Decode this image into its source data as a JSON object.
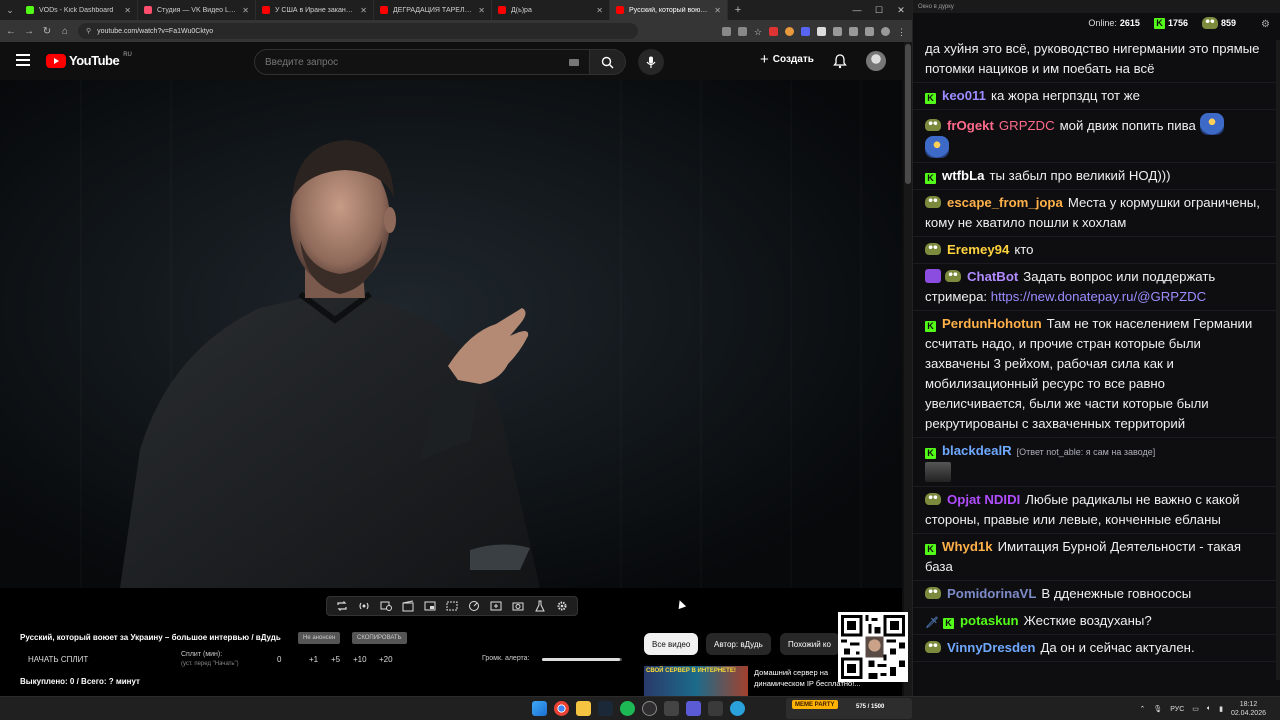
{
  "browser": {
    "tabs": [
      {
        "title": "VODs - Kick Dashboard",
        "color": "#53fc18",
        "active": false
      },
      {
        "title": "Студия — VK Видео Live",
        "color": "#ff4d6d",
        "active": false
      },
      {
        "title": "У США в Иране заканчиваются",
        "color": "#ff0000",
        "active": false
      },
      {
        "title": "ДЕГРАДАЦИЯ ТАРЕЛОЧНИЦ",
        "color": "#ff0000",
        "active": false
      },
      {
        "title": "Д(ь)ра",
        "color": "#ff0000",
        "active": false
      },
      {
        "title": "Русский, который воюет за Ук",
        "color": "#ff0000",
        "active": true
      }
    ],
    "url": "youtube.com/watch?v=Fa1Wu0Cktyo"
  },
  "youtube": {
    "logo_text": "YouTube",
    "logo_region": "RU",
    "search_placeholder": "Введите запрос",
    "create_label": "Создать"
  },
  "panel": {
    "video_title": "Русский, который воюет за Украину – большое интервью / вДудь",
    "pill_1": "Не анонсен",
    "pill_2": "СКОПИРОВАТЬ",
    "start_split": "НАЧАТЬ СПЛИТ",
    "split_label": "Сплит (мин):",
    "split_hint": "(уст. перед \"Начать\")",
    "steps": [
      "0",
      "+1",
      "+5",
      "+10",
      "+20"
    ],
    "volume_label": "Громк. алерта:",
    "volume_level": 0.98,
    "bought": "Выкуплено: 0 / Всего: ? минут",
    "chips": [
      {
        "label": "Все видео",
        "active": true
      },
      {
        "label": "Автор: вДудь",
        "active": false
      },
      {
        "label": "Похожий ко",
        "active": false
      }
    ],
    "rec_thumb_text": "СВОЙ СЕРВЕР В ИНТЕРНЕТЕ!",
    "rec_title": "Домашний сервер на динамическом IP бесплатно!..."
  },
  "chat": {
    "window_title": "Окно в дурку",
    "online_label": "Online:",
    "online_count": "2615",
    "kick_count": "1756",
    "other_count": "859",
    "messages": [
      {
        "icon": "",
        "user": "",
        "color": "#ffffff",
        "text": "да хуйня это всё, руководство нигермании это прямые потомки нациков и им поебать на всё"
      },
      {
        "icon": "kick",
        "user": "keo011",
        "color": "#9b8cff",
        "text": "ка жора негрпздц тот же"
      },
      {
        "icon": "frog",
        "user": "frOgekt",
        "user2": "GRPZDC",
        "color": "#ff6a8a",
        "text": "мой движ попить пива",
        "emote": true
      },
      {
        "icon": "kick",
        "user": "wtfbLa",
        "color": "#ffffff",
        "text": "ты забыл про великий НОД)))"
      },
      {
        "icon": "frog",
        "user": "escape_from_jopa",
        "color": "#ffb14a",
        "text": "Места у кормушки ограничены, кому не хватило пошли к хохлам"
      },
      {
        "icon": "frog",
        "user": "Eremey94",
        "color": "#ffd23f",
        "text": "кто"
      },
      {
        "icon": "bot",
        "user": "ChatBot",
        "color": "#b18cff",
        "text": "Задать вопрос или поддержать стримера:",
        "link": "https://new.donatepay.ru/@GRPZDC"
      },
      {
        "icon": "kick",
        "user": "PerdunHohotun",
        "color": "#ffb14a",
        "text": "Там не ток населением Германии ссчитать надо, и прочие стран которые были захвачены 3 рейхом, рабочая сила как и мобилизационный ресурс то все равно увелисчивается, были же части которые были рекрутированы с захваченных территорий"
      },
      {
        "icon": "kick",
        "user": "blackdealR",
        "color": "#6fa8ff",
        "reply": "[Ответ not_able: я сам на заводе]",
        "text": "",
        "emote2": true
      },
      {
        "icon": "frog",
        "user": "Opjat NDIDI",
        "color": "#b04dff",
        "text": "Любые радикалы не важно с какой стороны, правые или левые, конченные ебланы"
      },
      {
        "icon": "kick",
        "user": "Whyd1k",
        "color": "#ffb14a",
        "text": "Имитация Бурной Деятельности - такая база"
      },
      {
        "icon": "frog",
        "user": "PomidorinaVL",
        "color": "#7d8bc9",
        "text": "В дденежные говнососы"
      },
      {
        "icon": "kick",
        "user": "potaskun",
        "color": "#53fc18",
        "text": "Жесткие воздуханы?",
        "extra_icon": true
      },
      {
        "icon": "frog",
        "user": "VinnyDresden",
        "color": "#6fa8ff",
        "text": "Да он и сейчас актуален."
      }
    ]
  },
  "taskbar": {
    "app_badge": "MEME PARTY",
    "app_counter": "575 / 1500",
    "lang": "РУС",
    "time": "18:12",
    "date": "02.04.2026"
  }
}
